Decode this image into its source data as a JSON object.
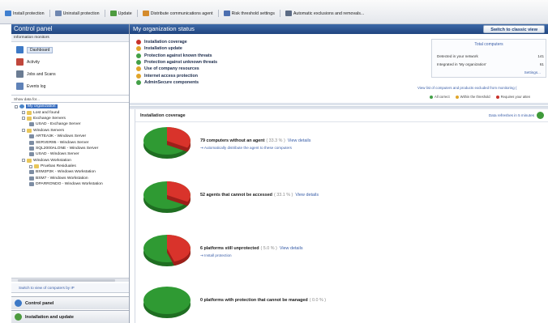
{
  "toolbar": {
    "items": [
      {
        "label": "Install protection",
        "icon": "install-icon",
        "color": "#3f7fcf"
      },
      {
        "label": "Uninstall protection",
        "icon": "uninstall-icon",
        "color": "#6f87b0"
      },
      {
        "label": "Update",
        "icon": "update-icon",
        "color": "#4d9b3f"
      },
      {
        "label": "Distribute communications agent",
        "icon": "distribute-icon",
        "color": "#d48b2c"
      },
      {
        "label": "Risk threshold settings",
        "icon": "risk-icon",
        "color": "#4c6fb0"
      },
      {
        "label": "Automatic exclusions and removals...",
        "icon": "exclusions-icon",
        "color": "#5b6b85"
      }
    ]
  },
  "left": {
    "title": "Control panel",
    "monitors_label": "Information monitors",
    "monitors": [
      {
        "label": "Dashboard",
        "icon": "dashboard-icon",
        "color": "#3d79c6"
      },
      {
        "label": "Activity",
        "icon": "activity-icon",
        "color": "#c0473c"
      },
      {
        "label": "Jobs and Scans",
        "icon": "jobs-icon",
        "color": "#6b7c93"
      },
      {
        "label": "Events log",
        "icon": "events-icon",
        "color": "#5f82b8"
      }
    ],
    "show_data": "Show data for...",
    "tree": [
      {
        "label": "My organization",
        "indent": 0,
        "icon": "globe-icon",
        "selected": true
      },
      {
        "label": "Lost and found",
        "indent": 1,
        "icon": "folder-icon"
      },
      {
        "label": "Exchange Servers",
        "indent": 1,
        "icon": "folder-icon"
      },
      {
        "label": "USAD - Exchange Server",
        "indent": 2,
        "icon": "computer-icon"
      },
      {
        "label": "Windows Servers",
        "indent": 1,
        "icon": "folder-icon"
      },
      {
        "label": "ARTEA3K - Windows Server",
        "indent": 2,
        "icon": "computer-icon"
      },
      {
        "label": "SERVER95 - Windows Server",
        "indent": 2,
        "icon": "computer-icon"
      },
      {
        "label": "SQL2000ALONE - Windows Server",
        "indent": 2,
        "icon": "computer-icon"
      },
      {
        "label": "USAD - Windows Server",
        "indent": 2,
        "icon": "computer-icon"
      },
      {
        "label": "Windows Workstation",
        "indent": 1,
        "icon": "folder-icon"
      },
      {
        "label": "Pruebas Residuales",
        "indent": 2,
        "icon": "folder-icon"
      },
      {
        "label": "BSM2P2K - Windows Workstation",
        "indent": 2,
        "icon": "computer-icon"
      },
      {
        "label": "BSM7 - Windows Workstation",
        "indent": 2,
        "icon": "computer-icon"
      },
      {
        "label": "DPARRONDO - Windows Workstation",
        "indent": 2,
        "icon": "computer-icon"
      }
    ],
    "switch_ip": "Switch to view of computers by IP",
    "nav": [
      {
        "label": "Control panel",
        "icon": "control-panel-icon",
        "color": "#3d79c6"
      },
      {
        "label": "Installation and update",
        "icon": "installation-icon",
        "color": "#4d9b3f"
      }
    ]
  },
  "right": {
    "title": "My organization status",
    "classic_button": "Switch to classic view",
    "status_items": [
      {
        "label": "Installation coverage",
        "color": "#c8322a"
      },
      {
        "label": "Installation update",
        "color": "#e1a52a"
      },
      {
        "label": "Protection against known threats",
        "color": "#43a047"
      },
      {
        "label": "Protection against unknown threats",
        "color": "#43a047"
      },
      {
        "label": "Use of company resources",
        "color": "#e1a52a"
      },
      {
        "label": "Internet access protection",
        "color": "#e1a52a"
      },
      {
        "label": "AdminSecure components",
        "color": "#43a047"
      }
    ],
    "totals": {
      "title": "Total computers",
      "detected_label": "Detected in your network",
      "detected_value": "141",
      "integrated_label": "Integrated in 'My organization'",
      "integrated_value": "61",
      "settings": "Settings..."
    },
    "excluded_link": "View list of computers and products excluded from monitoring (",
    "legend": [
      {
        "label": "All correct",
        "color": "#43a047"
      },
      {
        "label": "Within the threshold",
        "color": "#e1a52a"
      },
      {
        "label": "Requires your atten",
        "color": "#c8322a"
      }
    ]
  },
  "coverage": {
    "title": "Installation coverage",
    "refresh_label": "Data refreshes in 5 minutes",
    "rows": [
      {
        "bold": "79 computers without an agent",
        "muted": "( 33.3 % )",
        "link": "View details",
        "sub": "Automatically distribute the agent to these computers",
        "red_fraction": 0.333
      },
      {
        "bold": "52 agents that cannot be accessed",
        "muted": "( 33.1 % )",
        "link": "View details",
        "sub": "",
        "red_fraction": 0.331
      },
      {
        "bold": "6 platforms still unprotected",
        "muted": "( 5.0 % )",
        "link": "View details",
        "sub": "Install protection",
        "red_fraction": 0.45
      },
      {
        "bold": "0 platforms with protection that cannot be managed",
        "muted": "( 0.0 % )",
        "link": "",
        "sub": "",
        "red_fraction": 0.0
      }
    ],
    "colors": {
      "green": "#2f9a33",
      "red": "#d9332b"
    }
  }
}
